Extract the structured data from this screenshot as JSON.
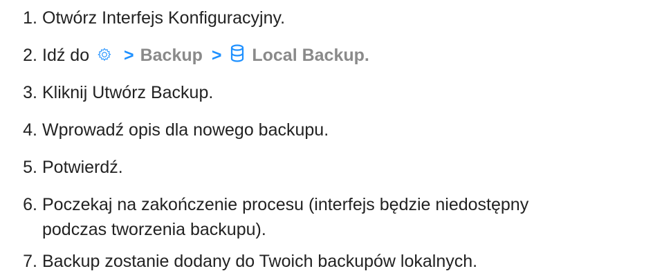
{
  "steps": [
    {
      "num": "1.",
      "text": "Otwórz Interfejs Konfiguracyjny."
    },
    {
      "num": "2.",
      "prefix": "Idź do",
      "icon1": "gear-icon",
      "sep1": ">",
      "item1": "Backup",
      "sep2": ">",
      "icon2": "database-icon",
      "item2": "Local Backup."
    },
    {
      "num": "3.",
      "text": "Kliknij Utwórz Backup."
    },
    {
      "num": "4.",
      "text": "Wprowadź opis dla nowego backupu."
    },
    {
      "num": "5.",
      "text": "Potwierdź."
    },
    {
      "num": "6.",
      "line1": "Poczekaj na zakończenie procesu (interfejs będzie niedostępny",
      "line2": "podczas tworzenia backupu)."
    },
    {
      "num": "7.",
      "text": "Backup zostanie dodany do Twoich backupów lokalnych."
    }
  ],
  "colors": {
    "text": "#222222",
    "nav": "#8a8a8a",
    "accent": "#1e90ff"
  }
}
